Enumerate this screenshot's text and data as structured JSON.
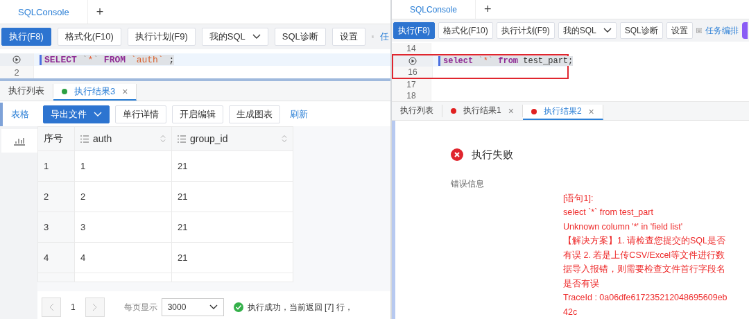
{
  "panes": [
    {
      "tabs": [
        {
          "label": "SQLConsole",
          "selected": true
        }
      ],
      "add_tab": "+",
      "toolbar": [
        {
          "kind": "primary",
          "label": "执行(F8)"
        },
        {
          "kind": "button",
          "label": "格式化(F10)"
        },
        {
          "kind": "button",
          "label": "执行计划(F9)"
        },
        {
          "kind": "dropdown",
          "label": "我的SQL"
        },
        {
          "kind": "button",
          "label": "SQL诊断"
        },
        {
          "kind": "button",
          "label": "设置"
        },
        {
          "kind": "keyboard"
        },
        {
          "kind": "link",
          "label": "任"
        }
      ],
      "editor": {
        "lines": [
          {
            "kind": "run",
            "selected": true,
            "boxed": false,
            "tokens": [
              {
                "kind": "keyword",
                "text": "SELECT"
              },
              {
                "kind": "quote",
                "text": " `"
              },
              {
                "kind": "star",
                "text": "*"
              },
              {
                "kind": "quote",
                "text": "` "
              },
              {
                "kind": "keyword",
                "text": "FROM"
              },
              {
                "kind": "string",
                "text": " `auth`"
              },
              {
                "kind": "plain",
                "text": " ;"
              }
            ]
          },
          {
            "kind": "number",
            "number": "2",
            "selected": false,
            "boxed": false
          }
        ]
      },
      "result_tabs": [
        {
          "kind": "plain",
          "label": "执行列表",
          "selected": false
        },
        {
          "kind": "result",
          "label": "执行结果3",
          "color": "#2ca042",
          "close": "×",
          "selected": true
        }
      ],
      "result": {
        "kind": "table",
        "toolbar": [
          {
            "kind": "tab",
            "label": "表格"
          },
          {
            "kind": "primary-dropdown",
            "label": "导出文件"
          },
          {
            "kind": "button",
            "label": "单行详情"
          },
          {
            "kind": "button",
            "label": "开启编辑"
          },
          {
            "kind": "button",
            "label": "生成图表"
          },
          {
            "kind": "link",
            "label": "刷新"
          }
        ],
        "columns": [
          {
            "kind": "index",
            "label": "序号"
          },
          {
            "kind": "field",
            "label": "auth"
          },
          {
            "kind": "field",
            "label": "group_id"
          }
        ],
        "rows": [
          [
            "1",
            "1",
            "21"
          ],
          [
            "2",
            "2",
            "21"
          ],
          [
            "3",
            "3",
            "21"
          ],
          [
            "4",
            "4",
            "21"
          ]
        ],
        "pagination": {
          "page": "1",
          "page_size_label": "每页显示",
          "page_size": "3000",
          "status": "执行成功，当前返回 [7] 行，"
        }
      }
    },
    {
      "tabs": [
        {
          "label": "SQLConsole",
          "selected": true
        }
      ],
      "add_tab": "+",
      "toolbar": [
        {
          "kind": "primary",
          "label": "执行(F8)"
        },
        {
          "kind": "button",
          "label": "格式化(F10)"
        },
        {
          "kind": "button",
          "label": "执行计划(F9)"
        },
        {
          "kind": "dropdown",
          "label": "我的SQL"
        },
        {
          "kind": "button",
          "label": "SQL诊断"
        },
        {
          "kind": "button",
          "label": "设置"
        },
        {
          "kind": "keyboard"
        },
        {
          "kind": "link",
          "label": "任务编排"
        },
        {
          "kind": "accent"
        }
      ],
      "editor": {
        "lines": [
          {
            "kind": "number",
            "number": "14",
            "selected": false,
            "boxed": false
          },
          {
            "kind": "run",
            "selected": true,
            "boxed": true,
            "tokens": [
              {
                "kind": "keyword",
                "text": "select"
              },
              {
                "kind": "quote",
                "text": " `"
              },
              {
                "kind": "star",
                "text": "*"
              },
              {
                "kind": "quote",
                "text": "` "
              },
              {
                "kind": "keyword",
                "text": "from"
              },
              {
                "kind": "plain",
                "text": " test_part;"
              }
            ]
          },
          {
            "kind": "number",
            "number": "16",
            "selected": false,
            "boxed": true
          },
          {
            "kind": "number",
            "number": "17",
            "selected": false,
            "boxed": false
          },
          {
            "kind": "number",
            "number": "18",
            "selected": false,
            "boxed": false
          }
        ]
      },
      "result_tabs": [
        {
          "kind": "plain",
          "label": "执行列表",
          "selected": false
        },
        {
          "kind": "result",
          "label": "执行结果1",
          "color": "#e02020",
          "close": "×",
          "selected": false
        },
        {
          "kind": "result",
          "label": "执行结果2",
          "color": "#e02020",
          "close": "×",
          "selected": true
        }
      ],
      "result": {
        "kind": "error",
        "title": "执行失败",
        "label": "错误信息",
        "message_lines": [
          "[语句1]:",
          "select `*` from test_part",
          "Unknown column '*' in 'field list'",
          "【解决方案】1. 请检查您提交的SQL是否",
          "有误 2. 若是上传CSV/Excel等文件进行数",
          "据导入报错，则需要检查文件首行字段名",
          "是否有误",
          "TraceId : 0a06dfe617235212048695609eb",
          "42c"
        ]
      }
    }
  ]
}
